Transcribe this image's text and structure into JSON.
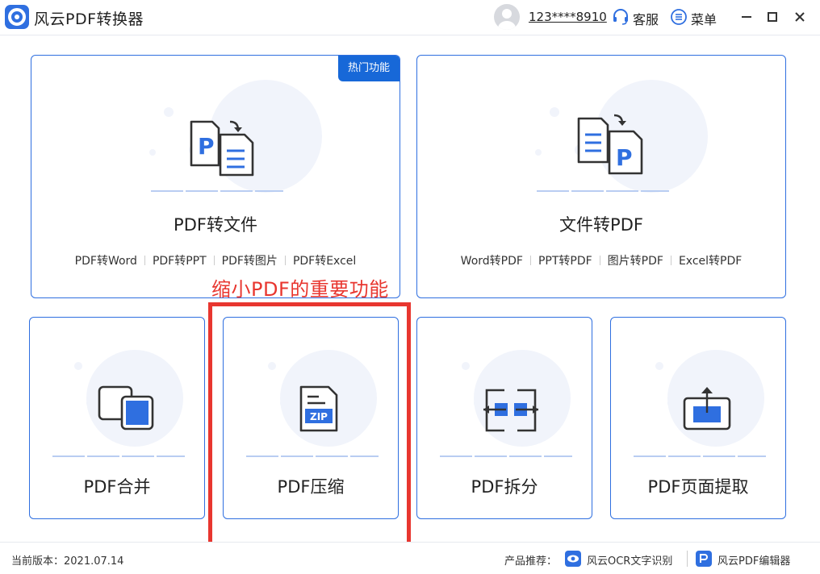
{
  "app": {
    "title": "风云PDF转换器",
    "account": "123****8910",
    "service_label": "客服",
    "menu_label": "菜单",
    "accent": "#2f6fe0"
  },
  "cards": {
    "to_file": {
      "title": "PDF转文件",
      "badge": "热门功能",
      "subs": [
        "PDF转Word",
        "PDF转PPT",
        "PDF转图片",
        "PDF转Excel"
      ],
      "icon": "pdf-to-document-icon"
    },
    "to_pdf": {
      "title": "文件转PDF",
      "subs": [
        "Word转PDF",
        "PPT转PDF",
        "图片转PDF",
        "Excel转PDF"
      ],
      "icon": "document-to-pdf-icon"
    },
    "merge": {
      "title": "PDF合并",
      "icon": "merge-icon"
    },
    "compress": {
      "title": "PDF压缩",
      "icon": "zip-file-icon",
      "icon_text": "ZIP"
    },
    "split": {
      "title": "PDF拆分",
      "icon": "split-icon"
    },
    "extract": {
      "title": "PDF页面提取",
      "icon": "extract-page-icon"
    }
  },
  "annotation": {
    "text": "缩小PDF的重要功能",
    "color": "#e8362f"
  },
  "footer": {
    "version": "当前版本：2021.07.14",
    "recommend_label": "产品推荐：",
    "ocr_label": "风云OCR文字识别",
    "editor_label": "风云PDF编辑器"
  }
}
